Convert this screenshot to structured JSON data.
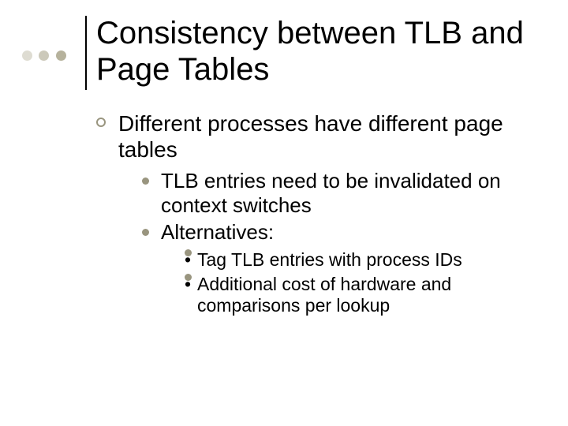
{
  "title": "Consistency between TLB and Page Tables",
  "bullets": {
    "lvl1": "Different processes have different page tables",
    "lvl2": [
      "TLB entries need to be invalidated on context switches",
      "Alternatives:"
    ],
    "lvl3": [
      "Tag TLB entries with process IDs",
      "Additional cost of hardware and comparisons per lookup"
    ]
  }
}
